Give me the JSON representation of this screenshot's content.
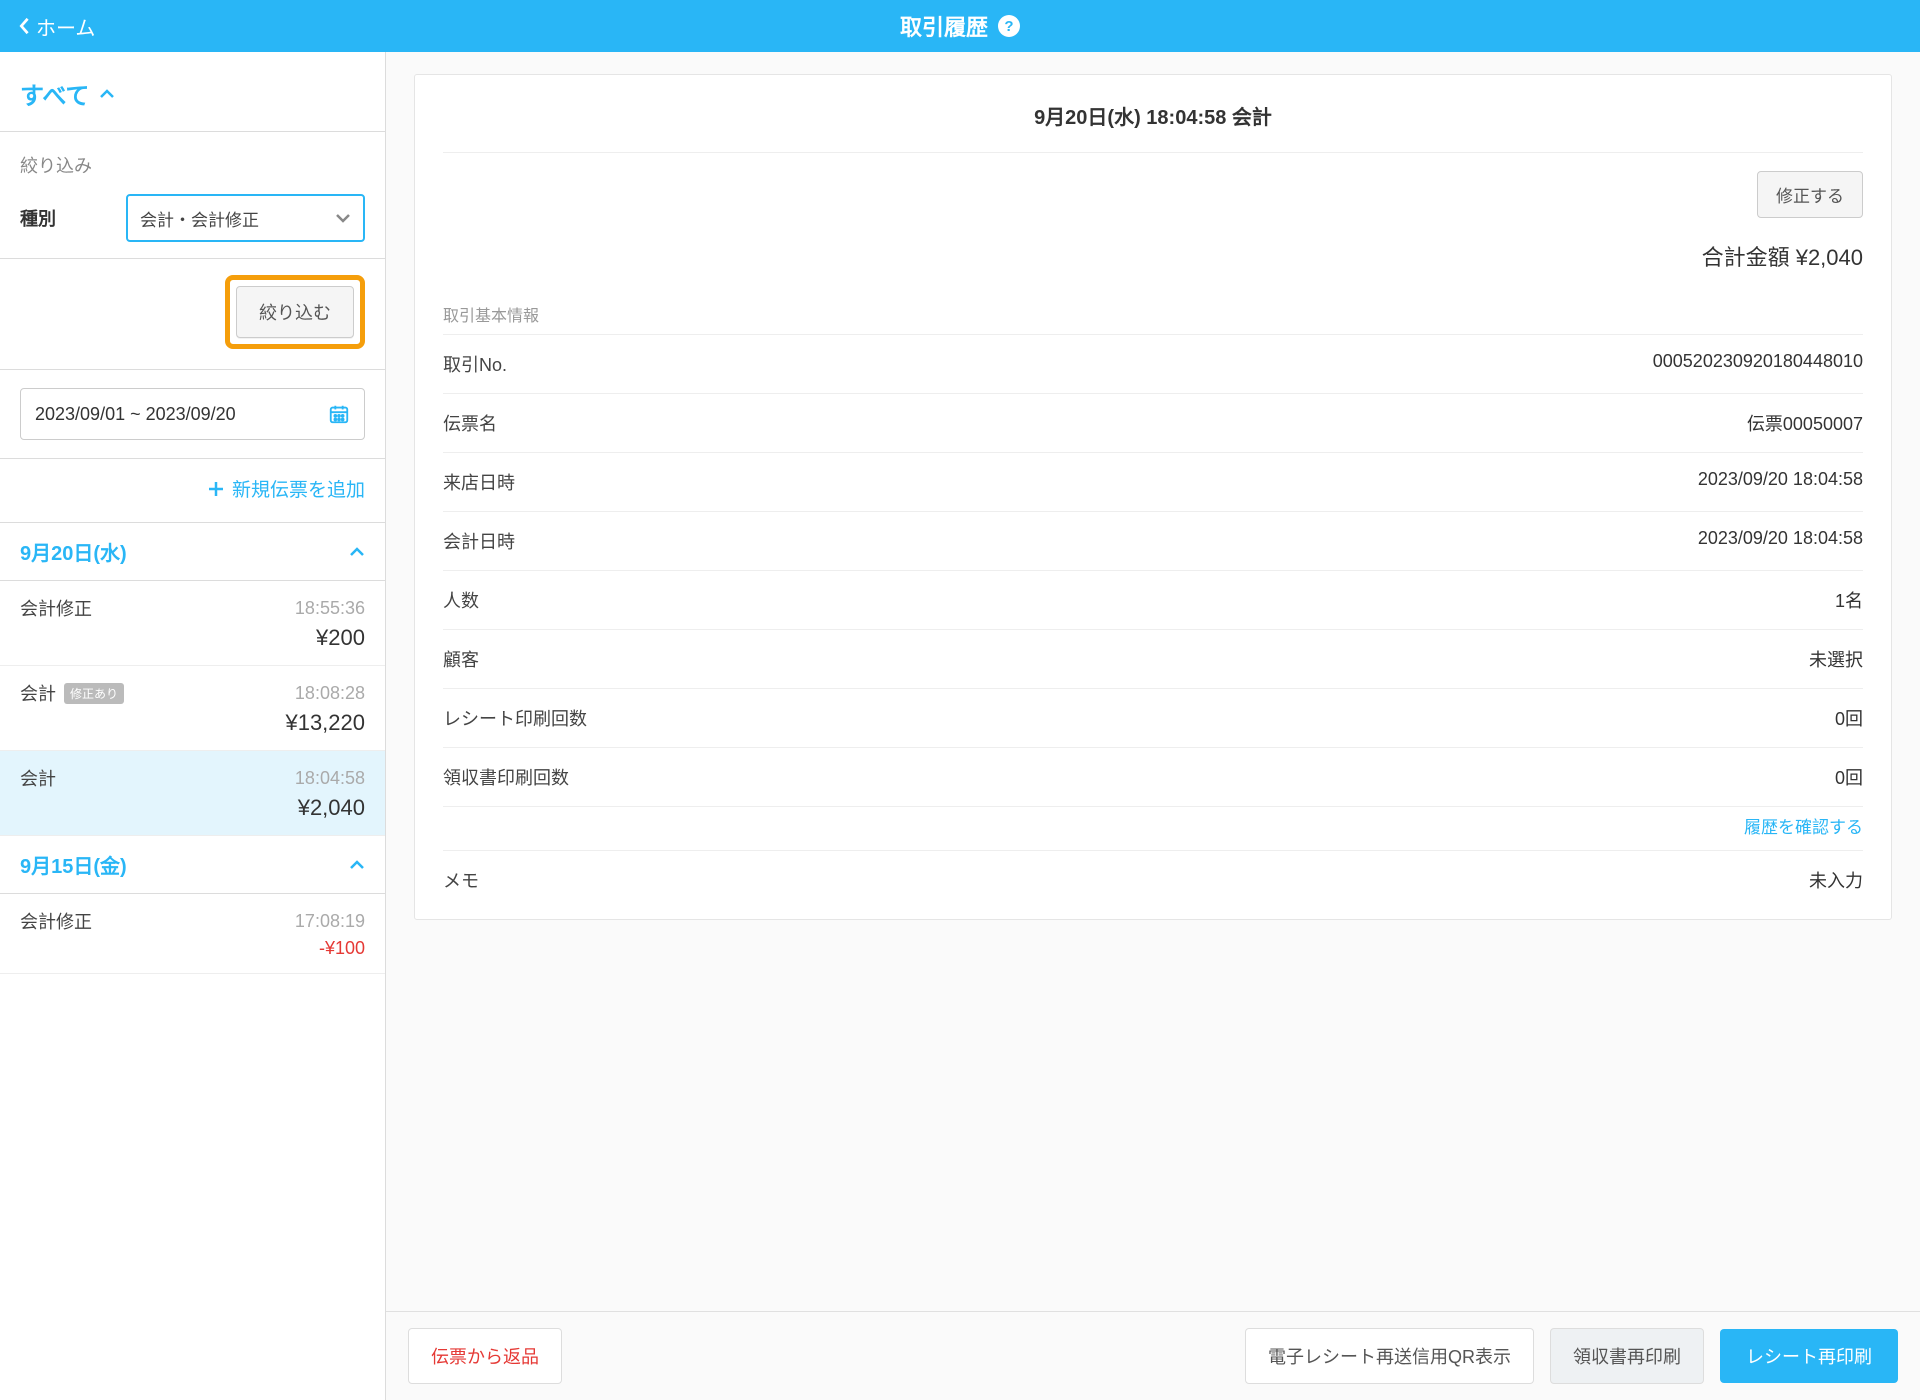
{
  "header": {
    "back_label": "ホーム",
    "title": "取引履歴"
  },
  "sidebar": {
    "all_label": "すべて",
    "filter_label": "絞り込み",
    "type_label": "種別",
    "type_value": "会計・会計修正",
    "apply_label": "絞り込む",
    "date_range": "2023/09/01 ~ 2023/09/20",
    "add_slip_label": "新規伝票を追加",
    "day1": {
      "label": "9月20日(水)"
    },
    "day2": {
      "label": "9月15日(金)"
    },
    "items": [
      {
        "type": "会計修正",
        "time": "18:55:36",
        "amount": "¥200"
      },
      {
        "type": "会計",
        "badge": "修正あり",
        "time": "18:08:28",
        "amount": "¥13,220"
      },
      {
        "type": "会計",
        "time": "18:04:58",
        "amount": "¥2,040"
      },
      {
        "type": "会計修正",
        "time": "17:08:19",
        "amount": "-¥100"
      }
    ]
  },
  "detail": {
    "header": "9月20日(水) 18:04:58 会計",
    "edit_label": "修正する",
    "total_label": "合計金額 ¥2,040",
    "section_basic": "取引基本情報",
    "rows": {
      "trans_no_label": "取引No.",
      "trans_no_value": "000520230920180448010",
      "slip_label": "伝票名",
      "slip_value": "伝票00050007",
      "visit_label": "来店日時",
      "visit_value": "2023/09/20 18:04:58",
      "acc_label": "会計日時",
      "acc_value": "2023/09/20 18:04:58",
      "people_label": "人数",
      "people_value": "1名",
      "customer_label": "顧客",
      "customer_value": "未選択",
      "receipt_label": "レシート印刷回数",
      "receipt_value": "0回",
      "ryoshu_label": "領収書印刷回数",
      "ryoshu_value": "0回",
      "memo_label": "メモ",
      "memo_value": "未入力"
    },
    "history_link": "履歴を確認する"
  },
  "footer": {
    "return_label": "伝票から返品",
    "qr_label": "電子レシート再送信用QR表示",
    "ryoshu_reprint": "領収書再印刷",
    "receipt_reprint": "レシート再印刷"
  }
}
